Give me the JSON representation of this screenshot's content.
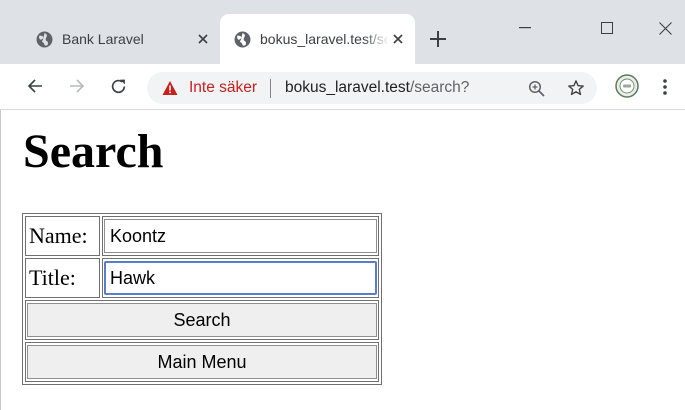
{
  "browser": {
    "tabs": [
      {
        "title": "Bank Laravel",
        "icon": "globe-icon",
        "active": false
      },
      {
        "title": "bokus_laravel.test/search?",
        "icon": "globe-icon",
        "active": true
      }
    ],
    "address_bar": {
      "security_label": "Inte säker",
      "url_host": "bokus_laravel.test",
      "url_path": "/search?"
    }
  },
  "page": {
    "title": "Search",
    "form": {
      "name_label": "Name:",
      "name_value": "Koontz",
      "title_label": "Title:",
      "title_value": "Hawk",
      "search_button": "Search",
      "main_menu_button": "Main Menu"
    }
  },
  "colors": {
    "titlebar_bg": "#dee1e6",
    "insecure_red": "#c5221f",
    "focus_border": "#5a7cd0"
  }
}
